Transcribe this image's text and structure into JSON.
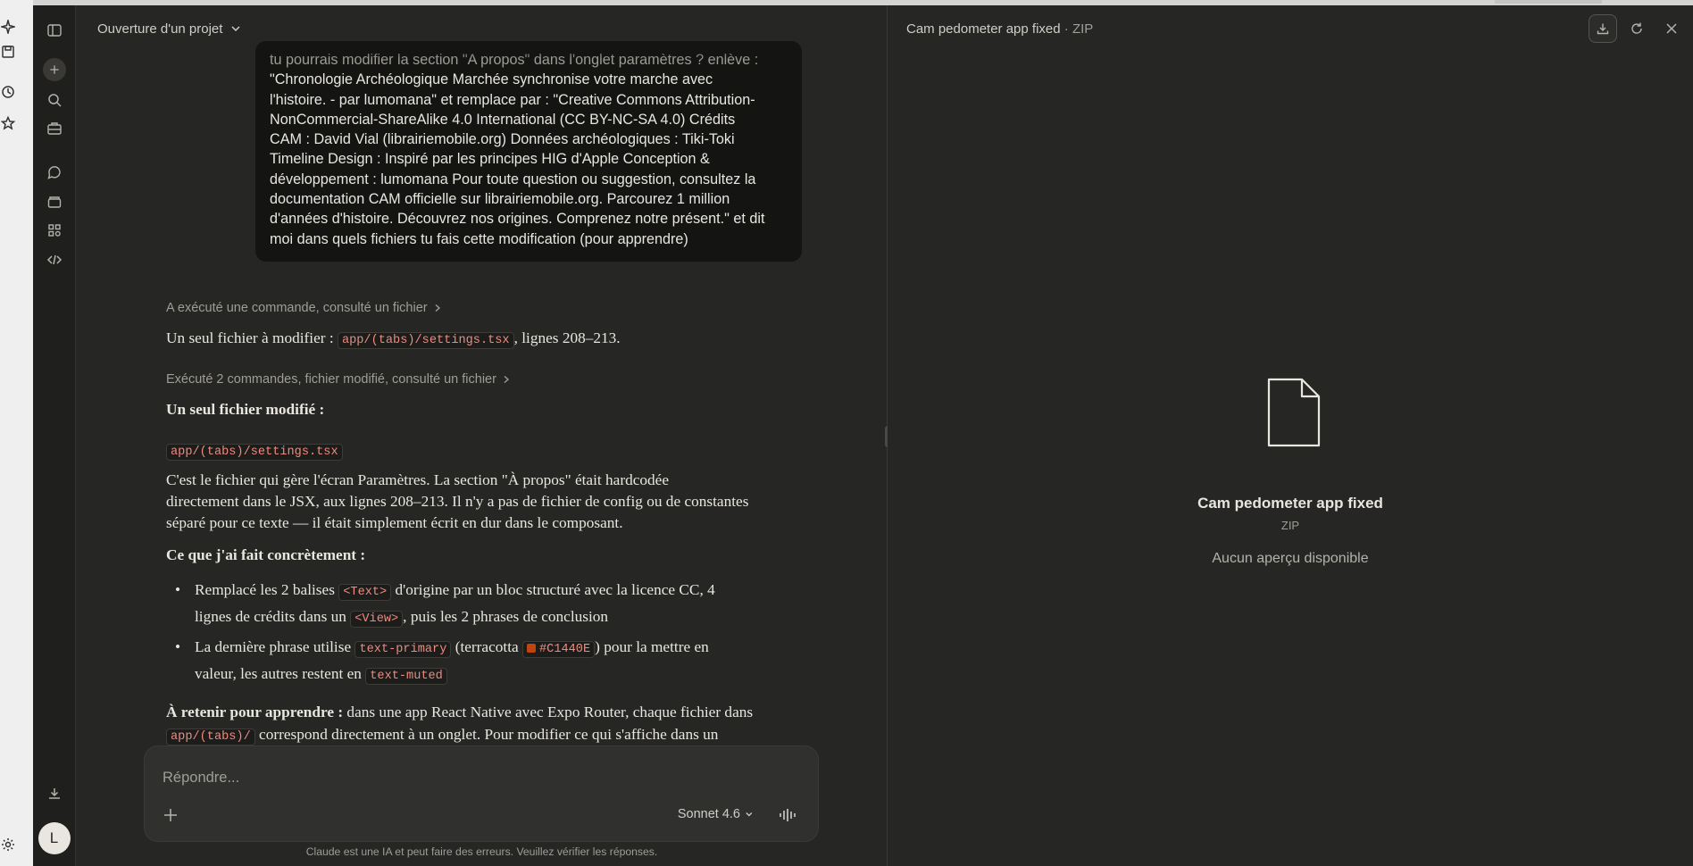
{
  "chat": {
    "project_title": "Ouverture d'un projet",
    "user_message_lines": [
      "tu pourrais modifier la section \"A propos\" dans l'onglet paramètres ?  enlève :",
      "\"Chronologie Archéologique Marchée synchronise votre marche avec",
      "l'histoire. - par lumomana\" et remplace par : \"Creative Commons Attribution-",
      "NonCommercial-ShareAlike 4.0 International (CC BY-NC-SA 4.0) Crédits",
      "CAM : David Vial (librairiemobile.org) Données archéologiques : Tiki-Toki",
      "Timeline Design : Inspiré par les principes HIG d'Apple Conception &",
      "développement : lumomana Pour toute question ou suggestion, consultez la",
      "documentation CAM officielle sur librairiemobile.org. Parcourez 1 million",
      "d'années d'histoire. Découvrez nos origines. Comprenez notre présent.\" et dit",
      "moi dans quels fichiers tu fais cette modification (pour apprendre)"
    ],
    "tool_summary_1": "A exécuté une commande, consulté un fichier",
    "answer_1_prefix": "Un seul fichier à modifier : ",
    "answer_1_code": "app/(tabs)/settings.tsx",
    "answer_1_suffix": ", lignes 208–213.",
    "tool_summary_2": "Exécuté 2 commandes, fichier modifié, consulté un fichier",
    "heading_modified": "Un seul fichier modifié :",
    "modified_file": "app/(tabs)/settings.tsx",
    "explain_lines": [
      "C'est le fichier qui gère l'écran Paramètres. La section \"À propos\" était hardcodée",
      "directement dans le JSX, aux lignes 208–213. Il n'y a pas de fichier de config ou de constantes",
      "séparé pour ce texte — il était simplement écrit en dur dans le composant."
    ],
    "heading_done": "Ce que j'ai fait concrètement :",
    "bullet_1": {
      "a": "Remplacé les 2 balises ",
      "code1": "<Text>",
      "b": " d'origine par un bloc structuré avec la licence CC, 4",
      "c": "lignes de crédits dans un ",
      "code2": "<View>",
      "d": ", puis les 2 phrases de conclusion"
    },
    "bullet_2": {
      "a": "La dernière phrase utilise ",
      "code1": "text-primary",
      "b": " (terracotta ",
      "color_code": "#C1440E",
      "c": ") pour la mettre en",
      "d": "valeur, les autres restent en ",
      "code2": "text-muted"
    },
    "retain_label": "À retenir pour apprendre :",
    "retain_text": " dans une app React Native avec Expo Router, chaque fichier dans",
    "retain_code": "app/(tabs)/",
    "retain_text_2": " correspond directement à un onglet. Pour modifier ce qui s'affiche dans un",
    "composer_placeholder": "Répondre...",
    "model_label": "Sonnet 4.6",
    "disclaimer": "Claude est une IA et peut faire des erreurs. Veuillez vérifier les réponses.",
    "avatar_initial": "L"
  },
  "panel": {
    "title": "Cam pedometer app fixed",
    "title_sep": " · ",
    "title_type": "ZIP",
    "file_name": "Cam pedometer app fixed",
    "file_type": "ZIP",
    "no_preview": "Aucun aperçu disponible"
  },
  "colors": {
    "background": "#262624",
    "rail": "#1f1f1d",
    "user_bubble": "#141413",
    "code_text": "#f08a7e",
    "terracotta": "#C1440E"
  }
}
